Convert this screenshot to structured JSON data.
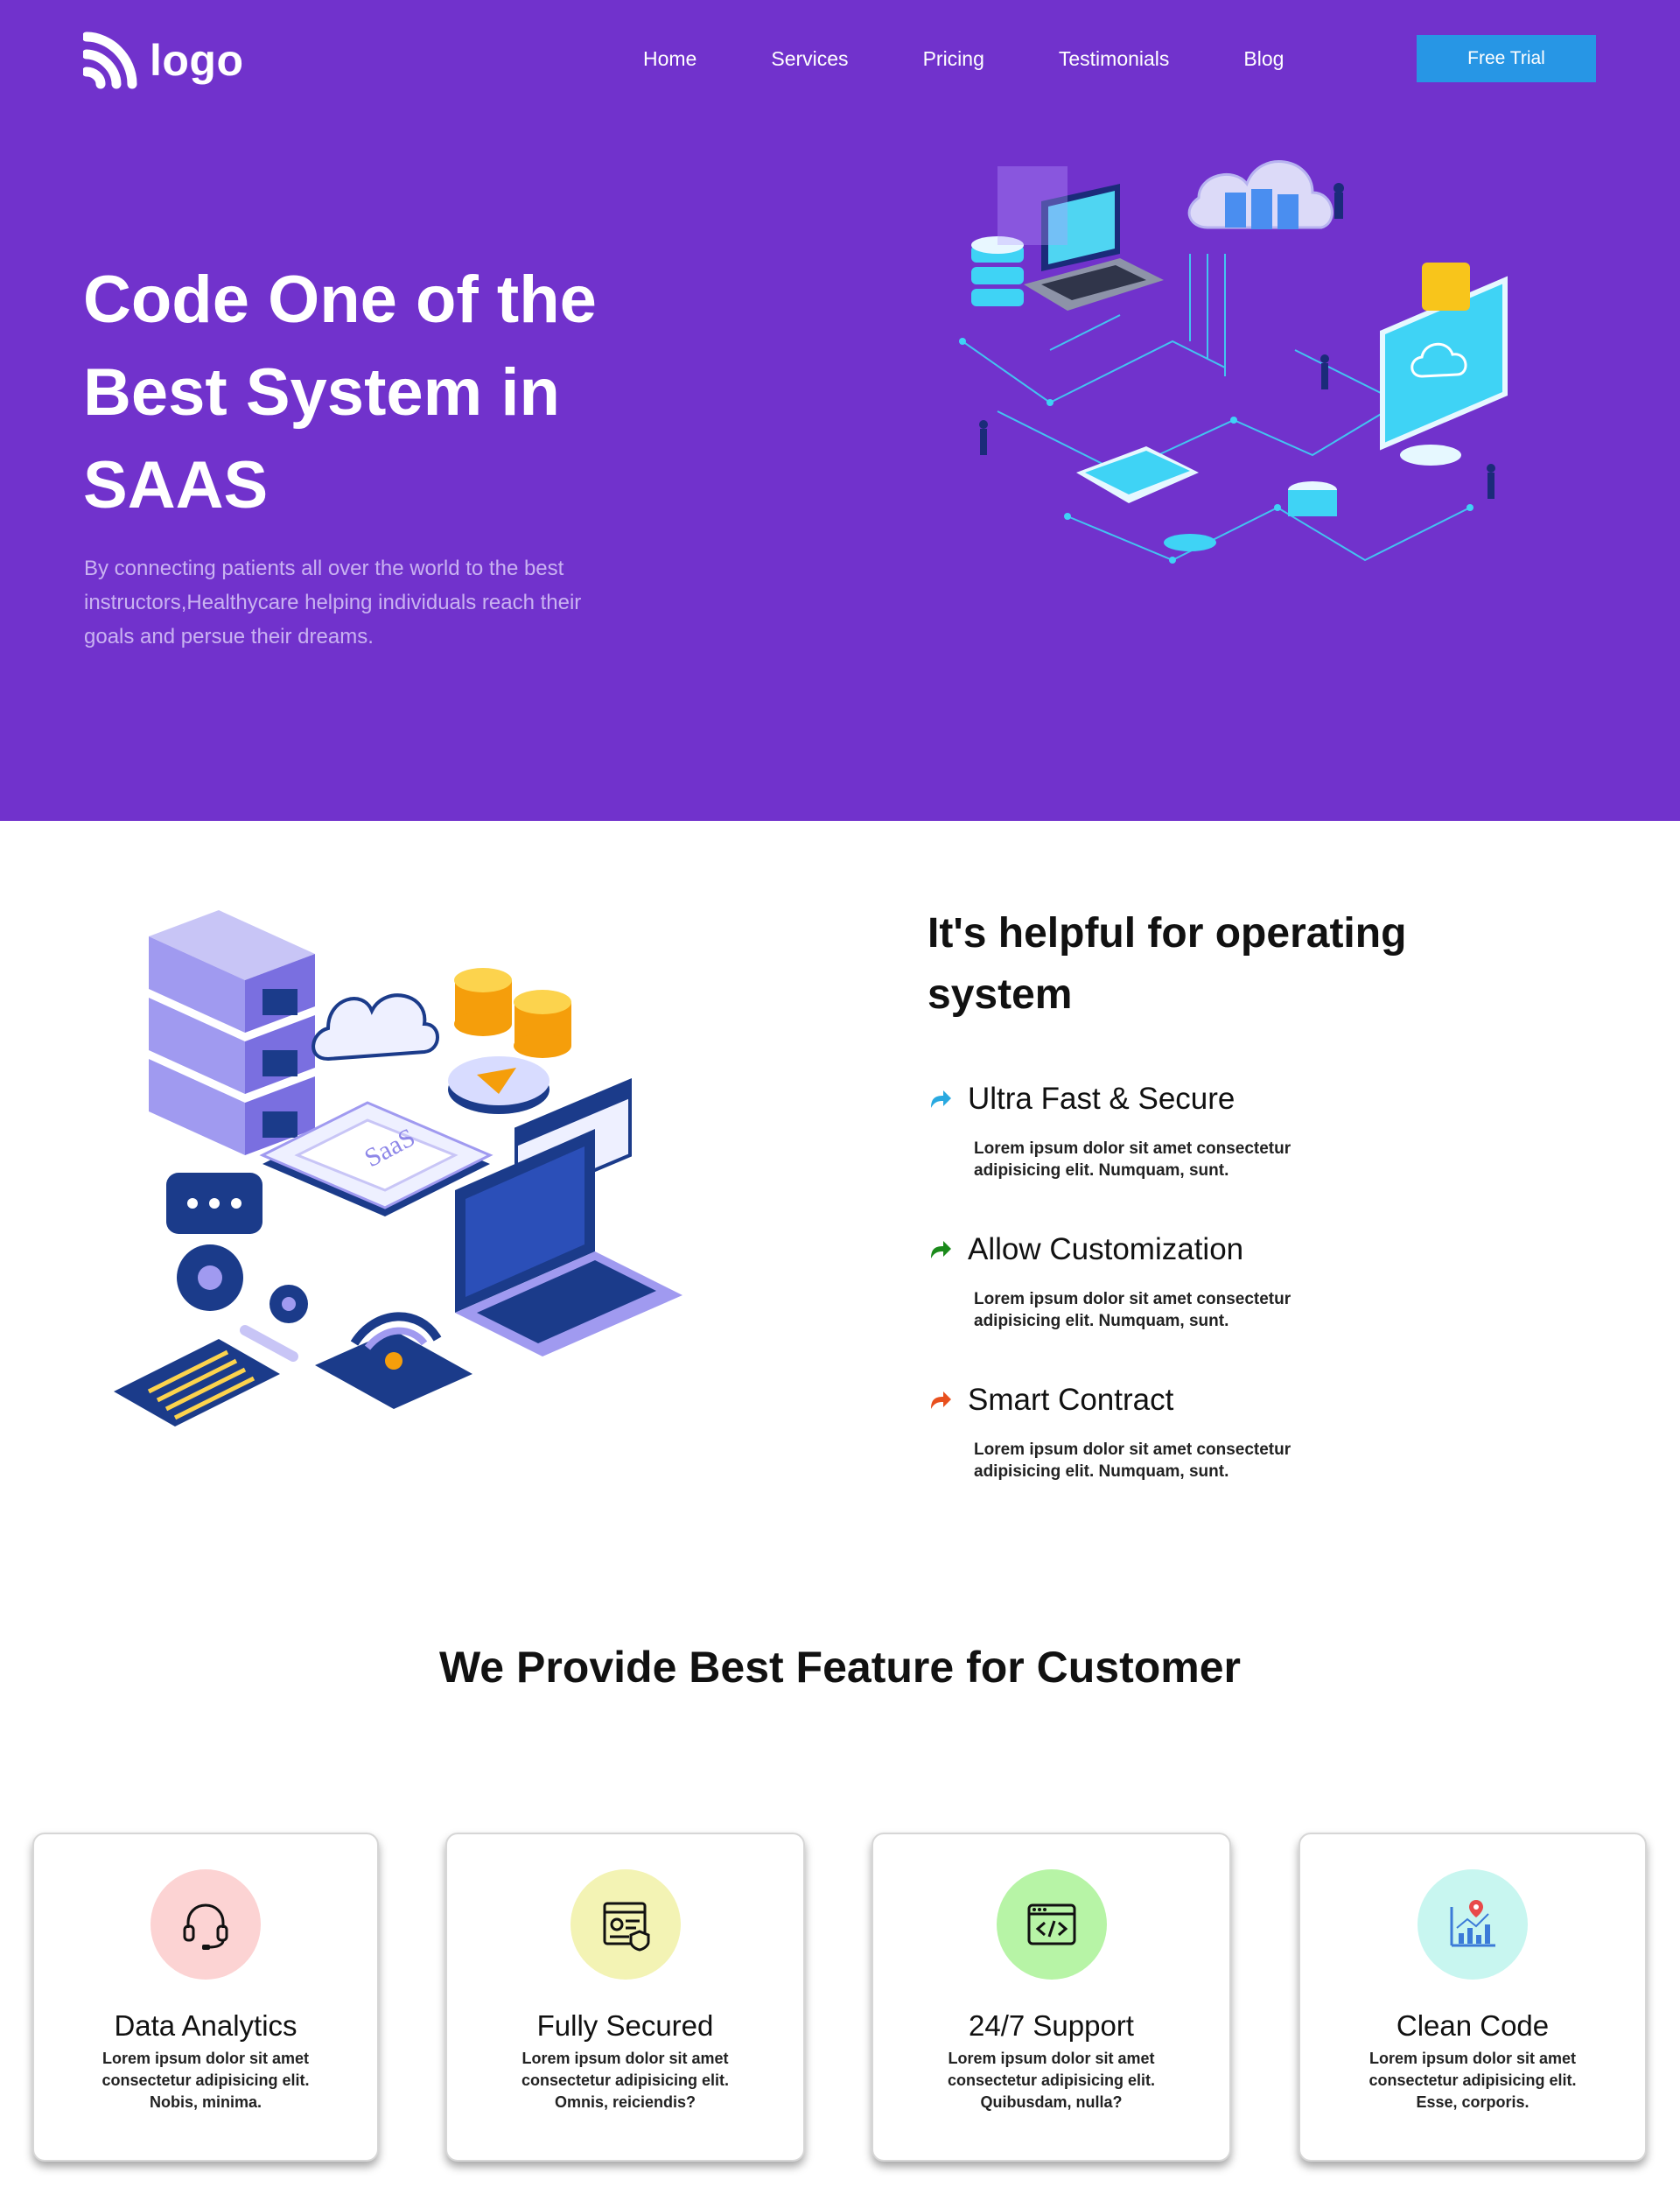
{
  "header": {
    "logo_text": "logo",
    "nav": [
      "Home",
      "Services",
      "Pricing",
      "Testimonials",
      "Blog"
    ],
    "cta_label": "Free Trial"
  },
  "hero": {
    "title": "Code One of the Best System in SAAS",
    "subtitle": "By connecting patients all over the world to the best instructors,Healthycare helping individuals reach their goals and persue their dreams."
  },
  "illustrations": {
    "saas_label": "SaaS"
  },
  "helpful": {
    "title": "It's helpful for operating system",
    "features": [
      {
        "title": "Ultra Fast & Secure",
        "text": "Lorem ipsum dolor sit amet consectetur adipisicing elit. Numquam, sunt.",
        "icon": "arrow-icon",
        "color": "#29a9e0"
      },
      {
        "title": "Allow Customization",
        "text": "Lorem ipsum dolor sit amet consectetur adipisicing elit. Numquam, sunt.",
        "icon": "arrow-icon",
        "color": "#1b8a1b"
      },
      {
        "title": "Smart Contract",
        "text": "Lorem ipsum dolor sit amet consectetur adipisicing elit. Numquam, sunt.",
        "icon": "arrow-icon",
        "color": "#e8501e"
      }
    ]
  },
  "features_section": {
    "title": "We Provide Best Feature for Customer",
    "cards": [
      {
        "title": "Data Analytics",
        "text": "Lorem ipsum dolor sit amet consectetur adipisicing elit. Nobis, minima.",
        "icon": "headset-icon",
        "bg": "#fcd3d3"
      },
      {
        "title": "Fully Secured",
        "text": "Lorem ipsum dolor sit amet consectetur adipisicing elit. Omnis, reiciendis?",
        "icon": "secure-document-icon",
        "bg": "#f3f3b4"
      },
      {
        "title": "24/7 Support",
        "text": "Lorem ipsum dolor sit amet consectetur adipisicing elit. Quibusdam, nulla?",
        "icon": "code-window-icon",
        "bg": "#b7f4a6"
      },
      {
        "title": "Clean Code",
        "text": "Lorem ipsum dolor sit amet consectetur adipisicing elit. Esse, corporis.",
        "icon": "analytics-chart-icon",
        "bg": "#c8f6f0"
      }
    ]
  }
}
